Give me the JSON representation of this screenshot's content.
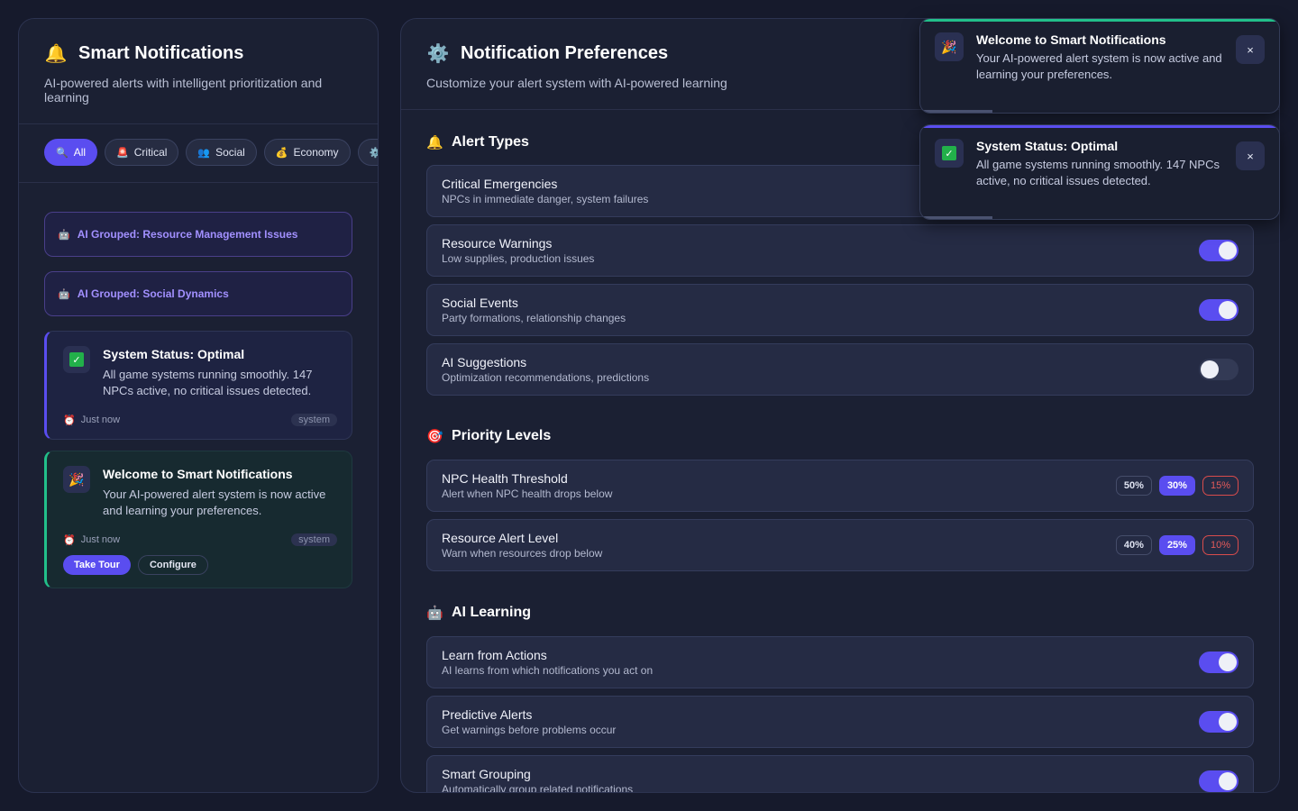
{
  "colors": {
    "accent": "#5a4df0",
    "success": "#22c08a",
    "danger": "#d94c4c",
    "bg": "#161a2c"
  },
  "left": {
    "title": "Smart Notifications",
    "title_icon": "bell-icon",
    "subtitle": "AI-powered alerts with intelligent prioritization and learning",
    "filters": [
      {
        "label": "All",
        "icon": "search-icon"
      },
      {
        "label": "Critical",
        "icon": "siren-icon"
      },
      {
        "label": "Social",
        "icon": "people-icon"
      },
      {
        "label": "Economy",
        "icon": "money-bag-icon"
      },
      {
        "label": "",
        "icon": "gear-icon"
      }
    ],
    "groups": [
      {
        "label": "AI Grouped: Resource Management Issues",
        "icon": "robot-icon"
      },
      {
        "label": "AI Grouped: Social Dynamics",
        "icon": "robot-icon"
      }
    ],
    "notifications": [
      {
        "title": "System Status: Optimal",
        "body": "All game systems running smoothly. 147 NPCs active, no critical issues detected.",
        "time": "Just now",
        "tag": "system",
        "icon": "check-icon"
      },
      {
        "title": "Welcome to Smart Notifications",
        "body": "Your AI-powered alert system is now active and learning your preferences.",
        "time": "Just now",
        "tag": "system",
        "icon": "party-popper-icon",
        "actions": [
          "Take Tour",
          "Configure"
        ]
      }
    ]
  },
  "right": {
    "title": "Notification Preferences",
    "title_icon": "gear-icon",
    "subtitle": "Customize your alert system with AI-powered learning",
    "alert_types": {
      "title": "Alert Types",
      "items": [
        {
          "title": "Critical Emergencies",
          "desc": "NPCs in immediate danger, system failures",
          "enabled": true
        },
        {
          "title": "Resource Warnings",
          "desc": "Low supplies, production issues",
          "enabled": true
        },
        {
          "title": "Social Events",
          "desc": "Party formations, relationship changes",
          "enabled": true
        },
        {
          "title": "AI Suggestions",
          "desc": "Optimization recommendations, predictions",
          "enabled": false
        }
      ]
    },
    "priority_levels": {
      "title": "Priority Levels",
      "items": [
        {
          "title": "NPC Health Threshold",
          "desc": "Alert when NPC health drops below",
          "options": [
            "50%",
            "30%",
            "15%"
          ],
          "selected": "30%"
        },
        {
          "title": "Resource Alert Level",
          "desc": "Warn when resources drop below",
          "options": [
            "40%",
            "25%",
            "10%"
          ],
          "selected": "25%"
        }
      ]
    },
    "ai_learning": {
      "title": "AI Learning",
      "items": [
        {
          "title": "Learn from Actions",
          "desc": "AI learns from which notifications you act on",
          "enabled": true
        },
        {
          "title": "Predictive Alerts",
          "desc": "Get warnings before problems occur",
          "enabled": true
        },
        {
          "title": "Smart Grouping",
          "desc": "Automatically group related notifications",
          "enabled": true
        }
      ]
    }
  },
  "toasts": [
    {
      "title": "Welcome to Smart Notifications",
      "body": "Your AI-powered alert system is now active and learning your preferences.",
      "close": "×",
      "icon": "party-popper-icon",
      "color": "#22c08a",
      "progress": 0.2
    },
    {
      "title": "System Status: Optimal",
      "body": "All game systems running smoothly. 147 NPCs active, no critical issues detected.",
      "close": "×",
      "icon": "check-icon",
      "color": "#5a4df0",
      "progress": 0.2
    }
  ]
}
